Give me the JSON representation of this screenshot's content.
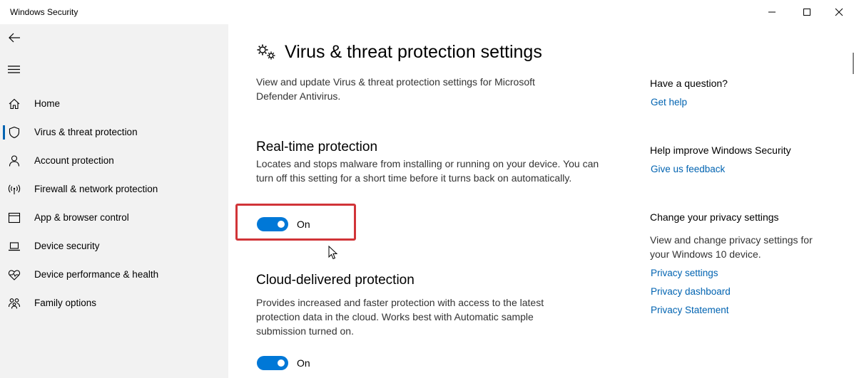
{
  "window": {
    "title": "Windows Security"
  },
  "sidebar": {
    "items": [
      {
        "label": "Home",
        "icon": "home-icon",
        "selected": false
      },
      {
        "label": "Virus & threat protection",
        "icon": "shield-icon",
        "selected": true
      },
      {
        "label": "Account protection",
        "icon": "person-icon",
        "selected": false
      },
      {
        "label": "Firewall & network protection",
        "icon": "wireless-icon",
        "selected": false
      },
      {
        "label": "App & browser control",
        "icon": "browser-window-icon",
        "selected": false
      },
      {
        "label": "Device security",
        "icon": "laptop-icon",
        "selected": false
      },
      {
        "label": "Device performance & health",
        "icon": "heart-pulse-icon",
        "selected": false
      },
      {
        "label": "Family options",
        "icon": "family-icon",
        "selected": false
      }
    ]
  },
  "main": {
    "title": "Virus & threat protection settings",
    "description": "View and update Virus & threat protection settings for Microsoft Defender Antivirus.",
    "sections": [
      {
        "title": "Real-time protection",
        "description": "Locates and stops malware from installing or running on your device. You can turn off this setting for a short time before it turns back on automatically.",
        "toggle_state": "On",
        "toggle_on": true
      },
      {
        "title": "Cloud-delivered protection",
        "description": "Provides increased and faster protection with access to the latest protection data in the cloud. Works best with Automatic sample submission turned on.",
        "toggle_state": "On",
        "toggle_on": true
      }
    ]
  },
  "aside": {
    "question_heading": "Have a question?",
    "get_help": "Get help",
    "improve_heading": "Help improve Windows Security",
    "feedback": "Give us feedback",
    "privacy_heading": "Change your privacy settings",
    "privacy_text": "View and change privacy settings for your Windows 10 device.",
    "privacy_links": [
      "Privacy settings",
      "Privacy dashboard",
      "Privacy Statement"
    ]
  },
  "colors": {
    "accent": "#0078d7",
    "link": "#0063b1",
    "highlight": "#d13438",
    "sidebar_bg": "#f2f2f2"
  }
}
